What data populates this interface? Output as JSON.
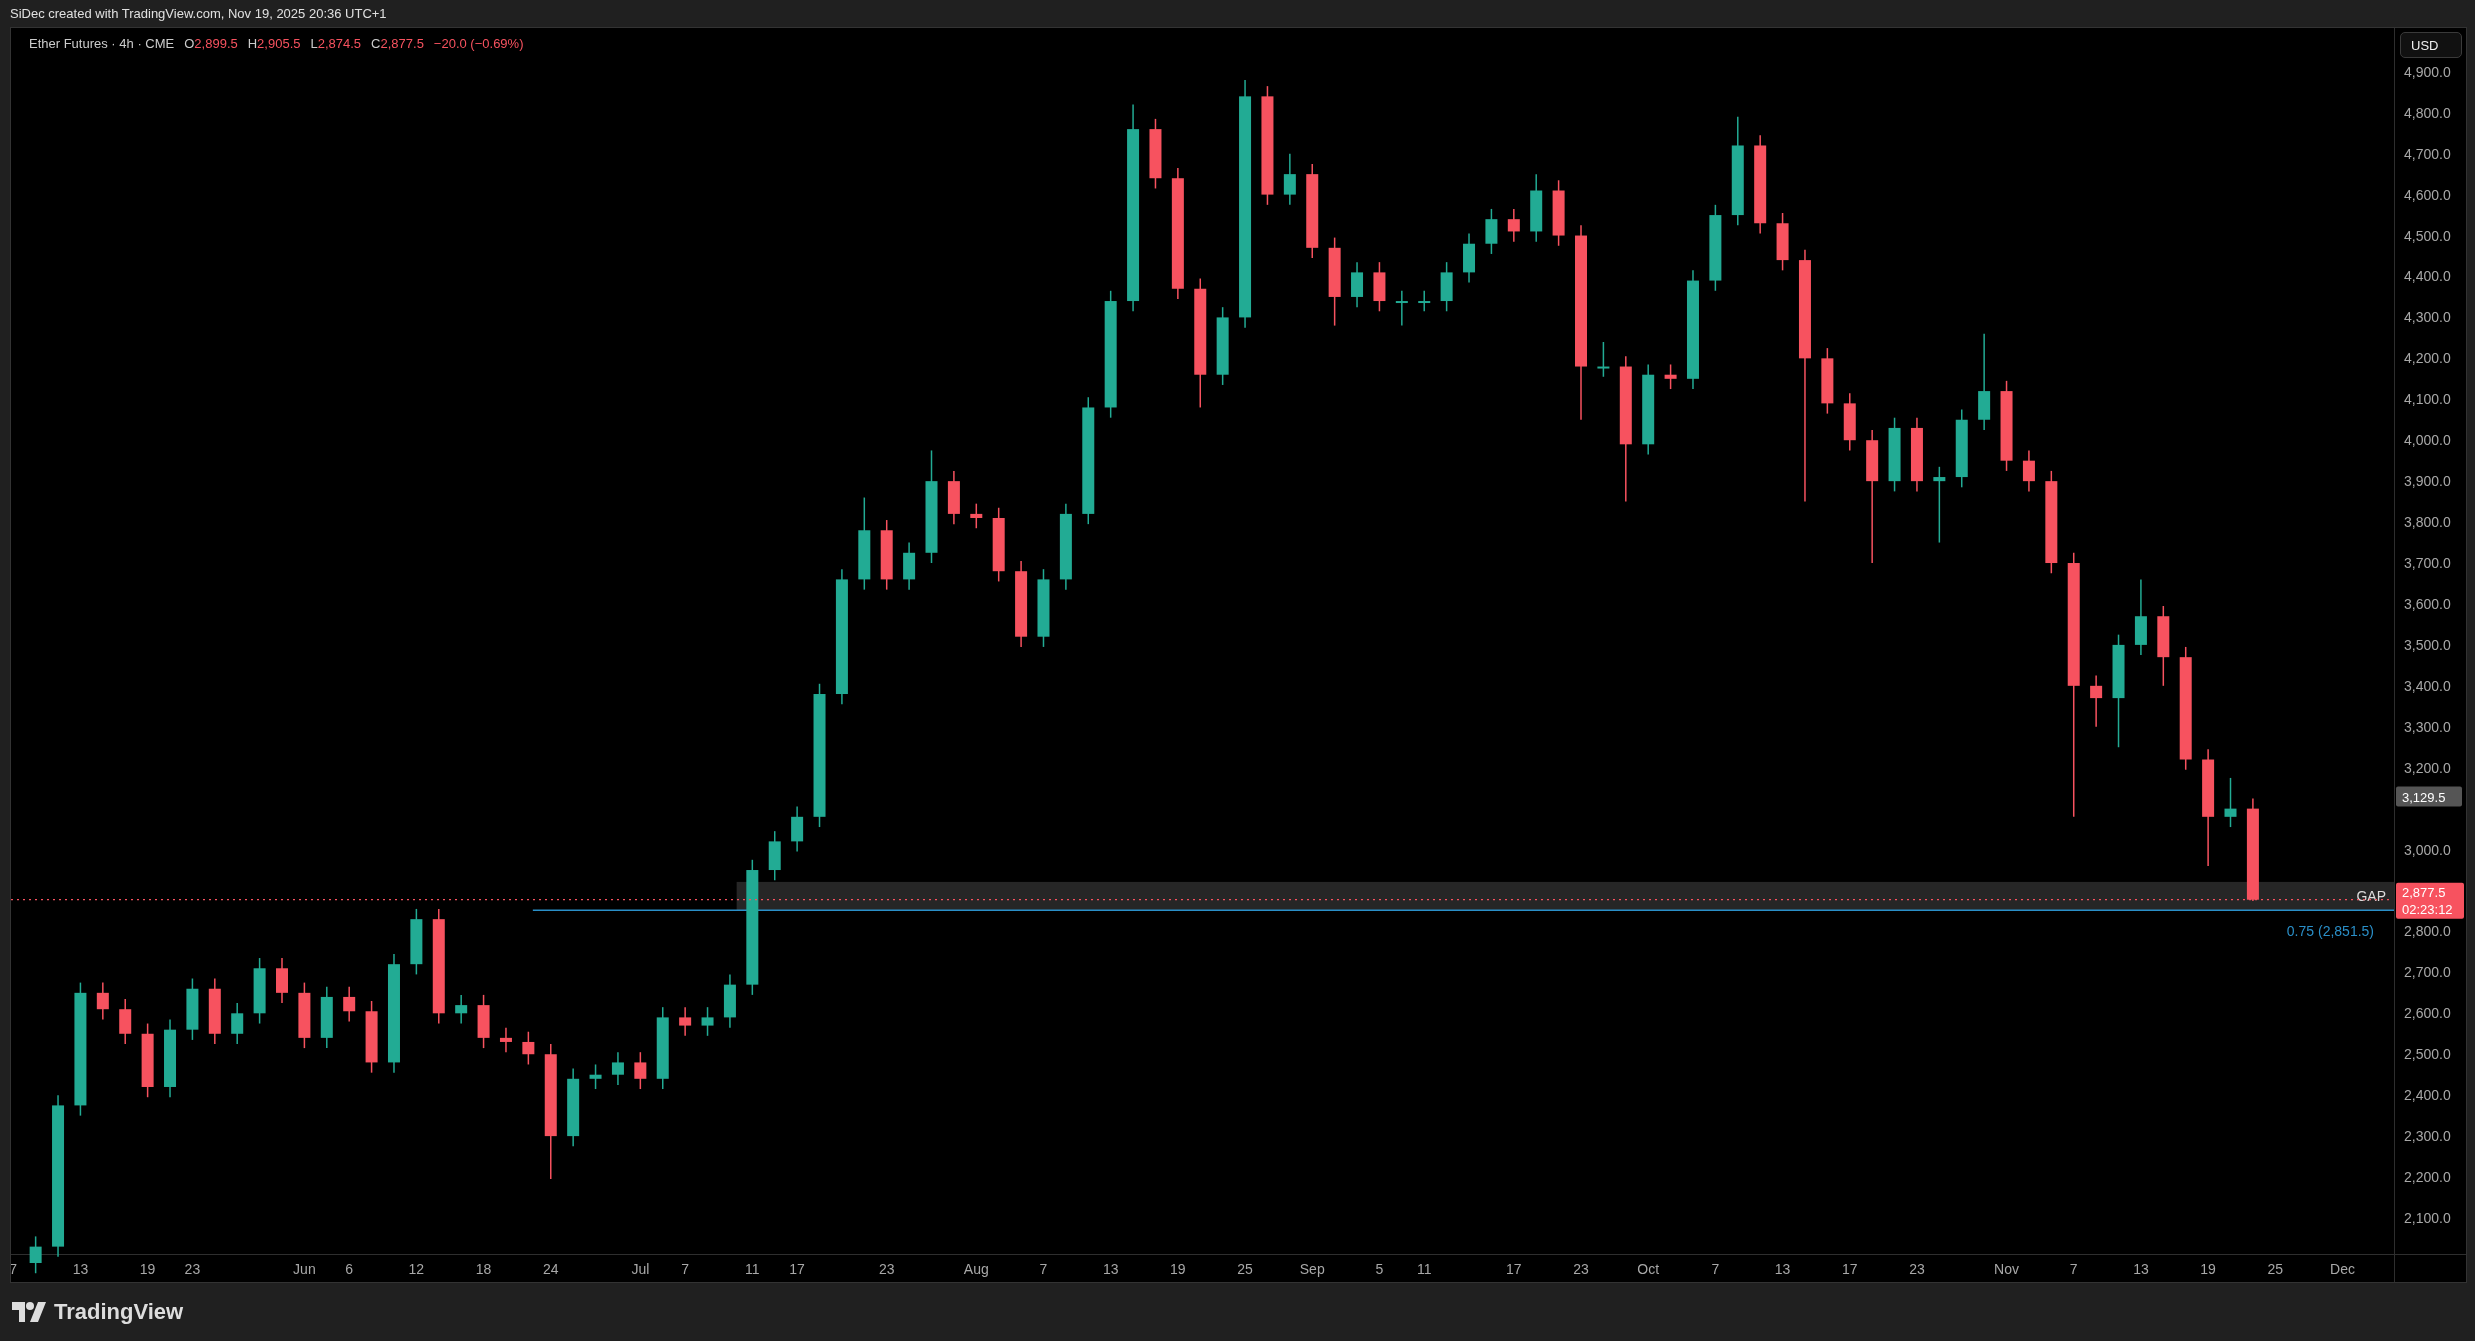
{
  "header": {
    "text": "SiDec created with TradingView.com, Nov 19, 2025 20:36 UTC+1"
  },
  "legend": {
    "symbol": "Ether Futures · 4h · CME",
    "ohlc": [
      {
        "key": "O",
        "value": "2,899.5"
      },
      {
        "key": "H",
        "value": "2,905.5"
      },
      {
        "key": "L",
        "value": "2,874.5"
      },
      {
        "key": "C",
        "value": "2,877.5"
      }
    ],
    "change": "−20.0 (−0.69%)"
  },
  "currency_button": {
    "label": "USD"
  },
  "chart": {
    "price_scale_labels": [
      {
        "kind": "marker",
        "value": "3,129.5"
      },
      {
        "kind": "last_price",
        "value": "2,877.5",
        "countdown": "02:23:12"
      }
    ],
    "chart_data": {
      "type": "candlestick",
      "ylim": [
        2012,
        5007
      ],
      "categories": [
        "7",
        null,
        null,
        "13",
        null,
        null,
        "19",
        null,
        "23",
        null,
        null,
        null,
        null,
        "Jun",
        null,
        "6",
        null,
        null,
        "12",
        null,
        null,
        "18",
        null,
        null,
        "24",
        null,
        null,
        null,
        "Jul",
        null,
        "7",
        null,
        null,
        "11",
        null,
        "17",
        null,
        null,
        null,
        "23",
        null,
        null,
        null,
        "Aug",
        null,
        null,
        "7",
        null,
        null,
        "13",
        null,
        null,
        "19",
        null,
        null,
        "25",
        null,
        null,
        "Sep",
        null,
        null,
        "5",
        null,
        "11",
        null,
        null,
        null,
        "17",
        null,
        null,
        "23",
        null,
        null,
        "Oct",
        null,
        null,
        "7",
        null,
        null,
        "13",
        null,
        null,
        "17",
        null,
        null,
        "23",
        null,
        null,
        null,
        "Nov",
        null,
        null,
        "7",
        null,
        null,
        "13",
        null,
        null,
        "19",
        null,
        null,
        "25",
        null,
        null,
        "Dec",
        null
      ],
      "ohlc": [
        null,
        [
          1990,
          2055,
          1965,
          2030
        ],
        [
          2030,
          2400,
          2005,
          2375
        ],
        [
          2375,
          2675,
          2350,
          2650
        ],
        [
          2650,
          2675,
          2585,
          2610
        ],
        [
          2610,
          2635,
          2525,
          2550
        ],
        [
          2550,
          2575,
          2395,
          2420
        ],
        [
          2420,
          2585,
          2395,
          2560
        ],
        [
          2560,
          2685,
          2535,
          2660
        ],
        [
          2660,
          2685,
          2525,
          2550
        ],
        [
          2550,
          2625,
          2525,
          2600
        ],
        [
          2600,
          2735,
          2575,
          2710
        ],
        [
          2710,
          2735,
          2625,
          2650
        ],
        [
          2650,
          2675,
          2515,
          2540
        ],
        [
          2540,
          2665,
          2515,
          2640
        ],
        [
          2640,
          2665,
          2580,
          2605
        ],
        [
          2605,
          2630,
          2455,
          2480
        ],
        [
          2480,
          2745,
          2455,
          2720
        ],
        [
          2720,
          2855,
          2695,
          2830
        ],
        [
          2830,
          2855,
          2575,
          2600
        ],
        [
          2600,
          2645,
          2575,
          2620
        ],
        [
          2620,
          2645,
          2515,
          2540
        ],
        [
          2540,
          2565,
          2505,
          2530
        ],
        [
          2530,
          2555,
          2475,
          2500
        ],
        [
          2500,
          2525,
          2195,
          2300
        ],
        [
          2300,
          2465,
          2275,
          2440
        ],
        [
          2440,
          2475,
          2415,
          2450
        ],
        [
          2450,
          2505,
          2425,
          2480
        ],
        [
          2480,
          2505,
          2415,
          2440
        ],
        [
          2440,
          2615,
          2415,
          2590
        ],
        [
          2590,
          2615,
          2545,
          2570
        ],
        [
          2570,
          2615,
          2545,
          2590
        ],
        [
          2590,
          2695,
          2565,
          2670
        ],
        [
          2670,
          2975,
          2645,
          2950
        ],
        [
          2950,
          3045,
          2925,
          3020
        ],
        [
          3020,
          3105,
          2995,
          3080
        ],
        [
          3080,
          3405,
          3055,
          3380
        ],
        [
          3380,
          3685,
          3355,
          3660
        ],
        [
          3660,
          3860,
          3635,
          3780
        ],
        [
          3780,
          3805,
          3635,
          3660
        ],
        [
          3660,
          3750,
          3635,
          3725
        ],
        [
          3725,
          3975,
          3700,
          3900
        ],
        [
          3900,
          3925,
          3795,
          3820
        ],
        [
          3820,
          3845,
          3785,
          3810
        ],
        [
          3810,
          3835,
          3655,
          3680
        ],
        [
          3680,
          3705,
          3495,
          3520
        ],
        [
          3520,
          3685,
          3495,
          3660
        ],
        [
          3660,
          3845,
          3635,
          3820
        ],
        [
          3820,
          4105,
          3795,
          4080
        ],
        [
          4080,
          4365,
          4055,
          4340
        ],
        [
          4340,
          4820,
          4315,
          4760
        ],
        [
          4760,
          4785,
          4615,
          4640
        ],
        [
          4640,
          4665,
          4345,
          4370
        ],
        [
          4370,
          4395,
          4080,
          4160
        ],
        [
          4160,
          4325,
          4135,
          4300
        ],
        [
          4300,
          4880,
          4275,
          4840
        ],
        [
          4840,
          4865,
          4575,
          4600
        ],
        [
          4600,
          4700,
          4575,
          4650
        ],
        [
          4650,
          4675,
          4445,
          4470
        ],
        [
          4470,
          4495,
          4280,
          4350
        ],
        [
          4350,
          4435,
          4325,
          4410
        ],
        [
          4410,
          4435,
          4315,
          4340
        ],
        [
          4340,
          4365,
          4280,
          4340
        ],
        [
          4340,
          4365,
          4315,
          4340
        ],
        [
          4340,
          4435,
          4315,
          4410
        ],
        [
          4410,
          4505,
          4385,
          4480
        ],
        [
          4480,
          4565,
          4455,
          4540
        ],
        [
          4540,
          4565,
          4485,
          4510
        ],
        [
          4510,
          4650,
          4485,
          4610
        ],
        [
          4610,
          4635,
          4475,
          4500
        ],
        [
          4500,
          4525,
          4050,
          4180
        ],
        [
          4180,
          4240,
          4155,
          4180
        ],
        [
          4180,
          4205,
          3850,
          3990
        ],
        [
          3990,
          4185,
          3965,
          4160
        ],
        [
          4160,
          4185,
          4125,
          4150
        ],
        [
          4150,
          4415,
          4125,
          4390
        ],
        [
          4390,
          4575,
          4365,
          4550
        ],
        [
          4550,
          4790,
          4525,
          4720
        ],
        [
          4720,
          4745,
          4505,
          4530
        ],
        [
          4530,
          4555,
          4415,
          4440
        ],
        [
          4440,
          4465,
          3850,
          4200
        ],
        [
          4200,
          4225,
          4065,
          4090
        ],
        [
          4090,
          4115,
          3975,
          4000
        ],
        [
          4000,
          4025,
          3700,
          3900
        ],
        [
          3900,
          4055,
          3875,
          4030
        ],
        [
          4030,
          4055,
          3875,
          3900
        ],
        [
          3900,
          3935,
          3750,
          3910
        ],
        [
          3910,
          4075,
          3885,
          4050
        ],
        [
          4050,
          4260,
          4025,
          4120
        ],
        [
          4120,
          4145,
          3925,
          3950
        ],
        [
          3950,
          3975,
          3875,
          3900
        ],
        [
          3900,
          3925,
          3675,
          3700
        ],
        [
          3700,
          3725,
          3080,
          3400
        ],
        [
          3400,
          3425,
          3300,
          3370
        ],
        [
          3370,
          3525,
          3250,
          3500
        ],
        [
          3500,
          3660,
          3475,
          3570
        ],
        [
          3570,
          3595,
          3400,
          3470
        ],
        [
          3470,
          3495,
          3195,
          3220
        ],
        [
          3220,
          3245,
          2960,
          3080
        ],
        [
          3080,
          3175,
          3055,
          3100
        ],
        [
          3100,
          3125,
          2874.5,
          2877.5
        ],
        null,
        null,
        null,
        null,
        null
      ],
      "yticks": [
        {
          "value": 2100,
          "label": "2,100.0"
        },
        {
          "value": 2200,
          "label": "2,200.0"
        },
        {
          "value": 2300,
          "label": "2,300.0"
        },
        {
          "value": 2400,
          "label": "2,400.0"
        },
        {
          "value": 2500,
          "label": "2,500.0"
        },
        {
          "value": 2600,
          "label": "2,600.0"
        },
        {
          "value": 2700,
          "label": "2,700.0"
        },
        {
          "value": 2800,
          "label": "2,800.0"
        },
        {
          "value": 3000,
          "label": "3,000.0"
        },
        {
          "value": 3200,
          "label": "3,200.0"
        },
        {
          "value": 3300,
          "label": "3,300.0"
        },
        {
          "value": 3400,
          "label": "3,400.0"
        },
        {
          "value": 3500,
          "label": "3,500.0"
        },
        {
          "value": 3600,
          "label": "3,600.0"
        },
        {
          "value": 3700,
          "label": "3,700.0"
        },
        {
          "value": 3800,
          "label": "3,800.0"
        },
        {
          "value": 3900,
          "label": "3,900.0"
        },
        {
          "value": 4000,
          "label": "4,000.0"
        },
        {
          "value": 4100,
          "label": "4,100.0"
        },
        {
          "value": 4200,
          "label": "4,200.0"
        },
        {
          "value": 4300,
          "label": "4,300.0"
        },
        {
          "value": 4400,
          "label": "4,400.0"
        },
        {
          "value": 4500,
          "label": "4,500.0"
        },
        {
          "value": 4600,
          "label": "4,600.0"
        },
        {
          "value": 4700,
          "label": "4,700.0"
        },
        {
          "value": 4800,
          "label": "4,800.0"
        },
        {
          "value": 4900,
          "label": "4,900.0"
        }
      ]
    },
    "drawings": {
      "gap_label": "GAP",
      "level_label": "0.75 (2,851.5)"
    }
  },
  "footer": {
    "brand": "TradingView"
  }
}
